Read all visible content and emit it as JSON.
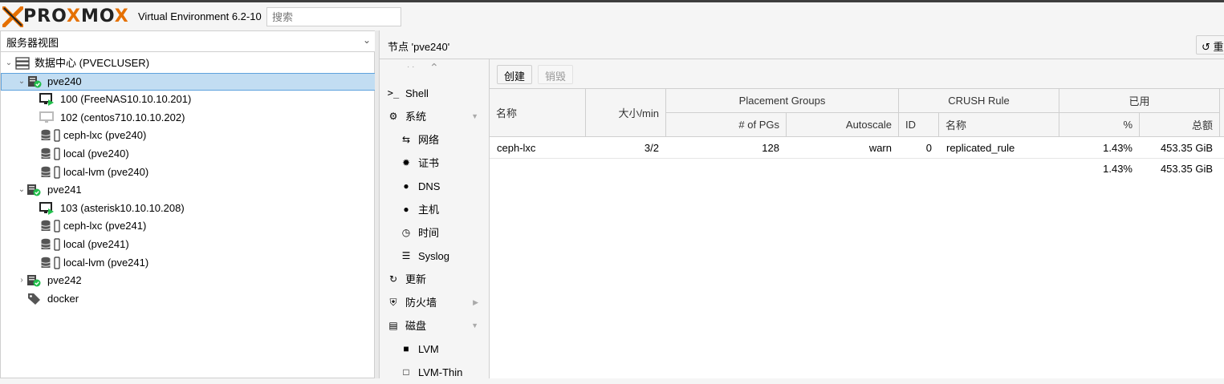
{
  "topbar": {
    "logo_text_left": "PRO",
    "logo_text_x": "X",
    "logo_text_mo": "MO",
    "logo_text_x2": "X",
    "version": "Virtual Environment 6.2-10",
    "search_placeholder": "搜索"
  },
  "left": {
    "view_select": "服务器视图",
    "tree": [
      {
        "label": "数据中心 (PVECLUSER)",
        "icon": "datacenter-icon"
      },
      {
        "label": "pve240",
        "icon": "node-online-icon",
        "selected": true
      },
      {
        "label": "100 (FreeNAS10.10.10.201)",
        "icon": "vm-running-icon"
      },
      {
        "label": "102 (centos710.10.10.202)",
        "icon": "vm-stopped-icon"
      },
      {
        "label": "ceph-lxc (pve240)",
        "icon": "storage-icon"
      },
      {
        "label": "local (pve240)",
        "icon": "storage-icon"
      },
      {
        "label": "local-lvm (pve240)",
        "icon": "storage-icon"
      },
      {
        "label": "pve241",
        "icon": "node-online-icon"
      },
      {
        "label": "103 (asterisk10.10.10.208)",
        "icon": "vm-running-icon"
      },
      {
        "label": "ceph-lxc (pve241)",
        "icon": "storage-icon"
      },
      {
        "label": "local (pve241)",
        "icon": "storage-icon"
      },
      {
        "label": "local-lvm (pve241)",
        "icon": "storage-icon"
      },
      {
        "label": "pve242",
        "icon": "node-online-icon"
      },
      {
        "label": "docker",
        "icon": "tag-icon"
      }
    ]
  },
  "content": {
    "node_title": "节点 'pve240'",
    "reload_label": "重"
  },
  "menu": {
    "items": [
      {
        "label": "Shell",
        "icon": "shell-icon"
      },
      {
        "label": "系统",
        "icon": "gears-icon"
      },
      {
        "label": "网络",
        "icon": "exchange-icon"
      },
      {
        "label": "证书",
        "icon": "certificate-icon"
      },
      {
        "label": "DNS",
        "icon": "globe-icon"
      },
      {
        "label": "主机",
        "icon": "globe-icon"
      },
      {
        "label": "时间",
        "icon": "clock-icon"
      },
      {
        "label": "Syslog",
        "icon": "list-icon"
      },
      {
        "label": "更新",
        "icon": "refresh-icon"
      },
      {
        "label": "防火墙",
        "icon": "shield-icon"
      },
      {
        "label": "磁盘",
        "icon": "hdd-icon"
      },
      {
        "label": "LVM",
        "icon": "square-icon"
      },
      {
        "label": "LVM-Thin",
        "icon": "square-outline-icon"
      }
    ]
  },
  "toolbar": {
    "create_label": "创建",
    "destroy_label": "销毁"
  },
  "grid": {
    "headers": {
      "name": "名称",
      "size_min": "大小/min",
      "placement_groups": "Placement Groups",
      "num_pgs": "# of PGs",
      "autoscale": "Autoscale",
      "crush_rule": "CRUSH Rule",
      "crush_id": "ID",
      "crush_name": "名称",
      "used": "已用",
      "used_pct": "%",
      "used_total": "总额"
    },
    "rows": [
      {
        "name": "ceph-lxc",
        "size_min": "3/2",
        "pgs": "128",
        "autoscale": "warn",
        "crush_id": "0",
        "crush_name": "replicated_rule",
        "used_pct": "1.43%",
        "used_total": "453.35 GiB"
      }
    ],
    "summary": {
      "used_pct": "1.43%",
      "used_total": "453.35 GiB"
    }
  }
}
